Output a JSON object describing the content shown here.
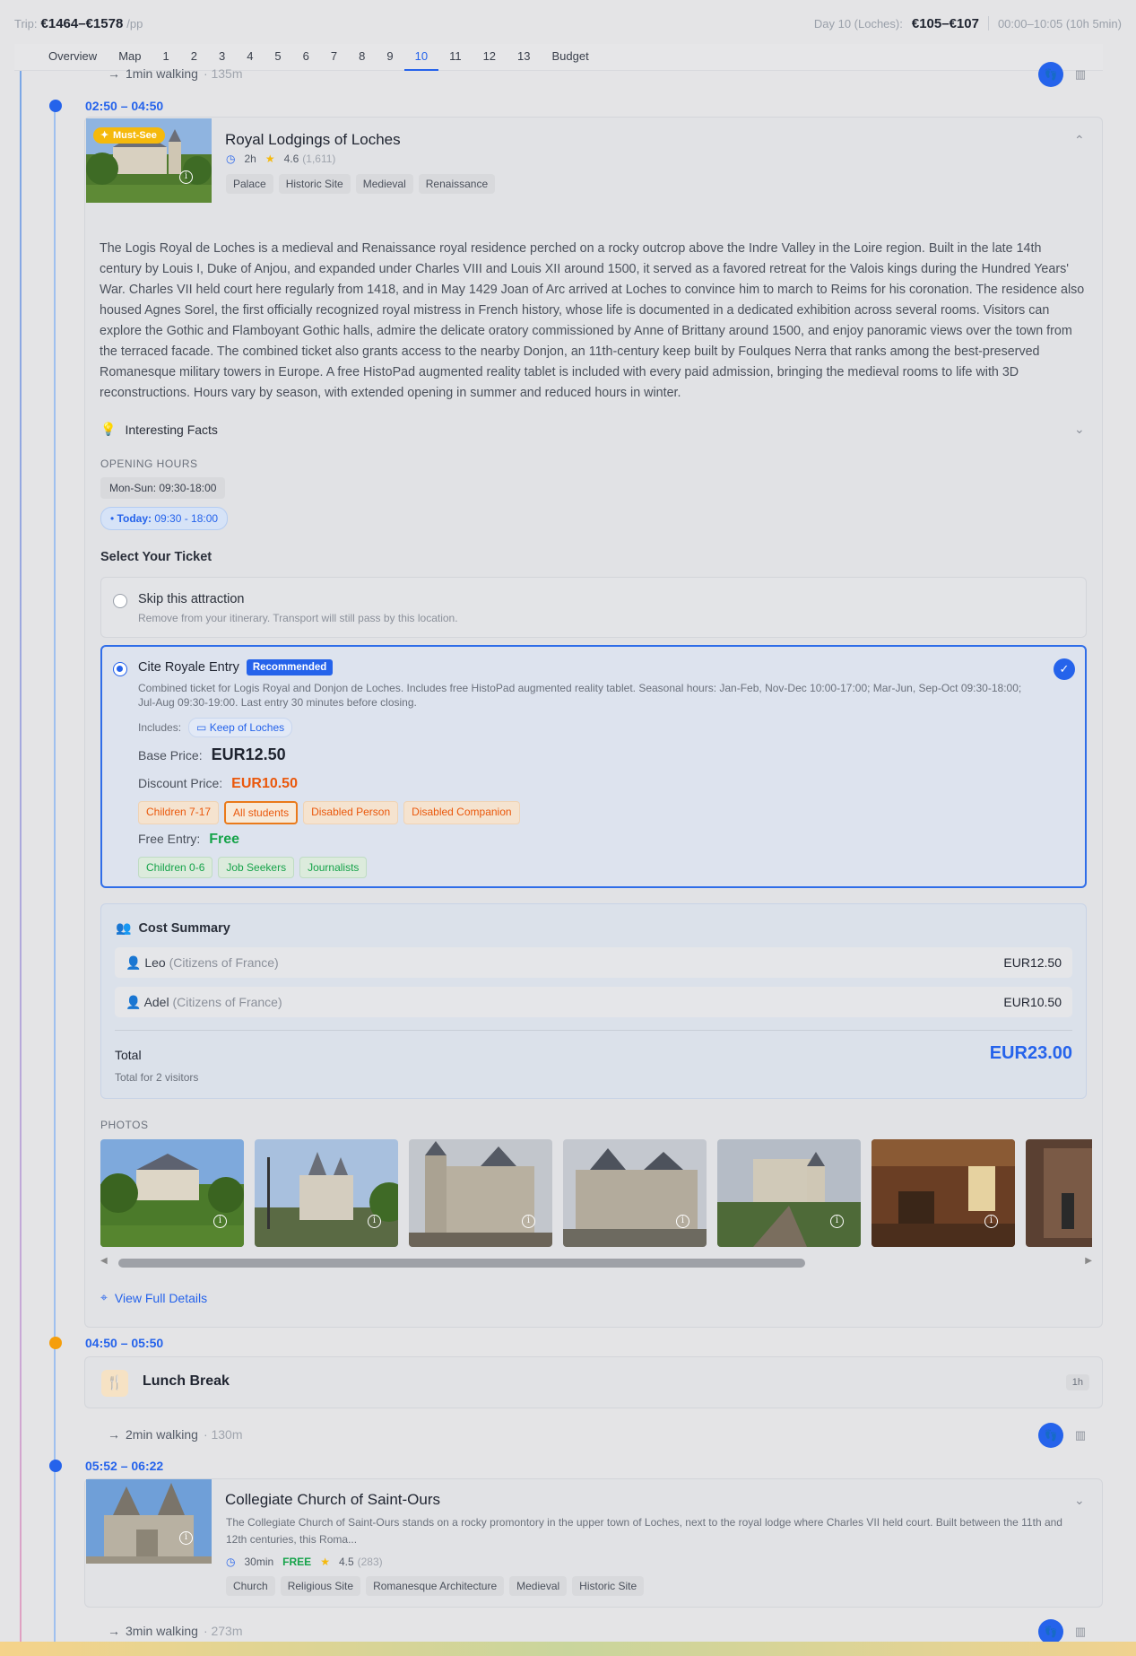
{
  "topbar": {
    "trip_label": "Trip:",
    "trip_value": "€1464–€1578",
    "trip_unit": "/pp",
    "day_label": "Day 10 (Loches):",
    "day_value": "€105–€107",
    "day_time": "00:00–10:05 (10h 5min)"
  },
  "tabs": [
    "Overview",
    "Map",
    "1",
    "2",
    "3",
    "4",
    "5",
    "6",
    "7",
    "8",
    "9",
    "10",
    "11",
    "12",
    "13",
    "Budget"
  ],
  "active_tab": "10",
  "walk1": {
    "label": "1min walking",
    "dist": "· 135m"
  },
  "main": {
    "time": "02:50 – 04:50",
    "badge": "Must-See",
    "title": "Royal Lodgings of Loches",
    "duration": "2h",
    "rating": "4.6",
    "reviews": "(1,611)",
    "tags": [
      "Palace",
      "Historic Site",
      "Medieval",
      "Renaissance"
    ],
    "description": "The Logis Royal de Loches is a medieval and Renaissance royal residence perched on a rocky outcrop above the Indre Valley in the Loire region. Built in the late 14th century by Louis I, Duke of Anjou, and expanded under Charles VIII and Louis XII around 1500, it served as a favored retreat for the Valois kings during the Hundred Years' War. Charles VII held court here regularly from 1418, and in May 1429 Joan of Arc arrived at Loches to convince him to march to Reims for his coronation. The residence also housed Agnes Sorel, the first officially recognized royal mistress in French history, whose life is documented in a dedicated exhibition across several rooms. Visitors can explore the Gothic and Flamboyant Gothic halls, admire the delicate oratory commissioned by Anne of Brittany around 1500, and enjoy panoramic views over the town from the terraced facade. The combined ticket also grants access to the nearby Donjon, an 11th-century keep built by Foulques Nerra that ranks among the best-preserved Romanesque military towers in Europe. A free HistoPad augmented reality tablet is included with every paid admission, bringing the medieval rooms to life with 3D reconstructions. Hours vary by season, with extended opening in summer and reduced hours in winter.",
    "facts_label": "Interesting Facts",
    "hours_title": "OPENING HOURS",
    "hours": "Mon-Sun: 09:30-18:00",
    "today_label": "Today:",
    "today_hours": "09:30 - 18:00",
    "select_ticket": "Select Your Ticket",
    "skip": {
      "title": "Skip this attraction",
      "sub": "Remove from your itinerary. Transport will still pass by this location."
    },
    "ticket": {
      "title": "Cite Royale Entry",
      "badge": "Recommended",
      "desc": "Combined ticket for Logis Royal and Donjon de Loches. Includes free HistoPad augmented reality tablet. Seasonal hours: Jan-Feb, Nov-Dec 10:00-17:00; Mar-Jun, Sep-Oct 09:30-18:00; Jul-Aug 09:30-19:00. Last entry 30 minutes before closing.",
      "includes_label": "Includes:",
      "includes": "Keep of Loches",
      "base_label": "Base Price:",
      "base_price": "EUR12.50",
      "discount_label": "Discount Price:",
      "discount_price": "EUR10.50",
      "discount_groups": [
        "Children 7-17",
        "All students",
        "Disabled Person",
        "Disabled Companion"
      ],
      "free_label": "Free Entry:",
      "free_value": "Free",
      "free_groups": [
        "Children 0-6",
        "Job Seekers",
        "Journalists"
      ]
    },
    "cost": {
      "title": "Cost Summary",
      "rows": [
        {
          "name": "Leo",
          "group": "(Citizens of France)",
          "price": "EUR12.50"
        },
        {
          "name": "Adel",
          "group": "(Citizens of France)",
          "price": "EUR10.50"
        }
      ],
      "total_label": "Total",
      "total_sub": "Total for 2 visitors",
      "total": "EUR23.00"
    },
    "photos_label": "PHOTOS",
    "view_details": "View Full Details"
  },
  "lunch": {
    "time": "04:50 – 05:50",
    "title": "Lunch Break",
    "duration": "1h"
  },
  "walk2": {
    "label": "2min walking",
    "dist": "· 130m"
  },
  "church": {
    "time": "05:52 – 06:22",
    "title": "Collegiate Church of Saint-Ours",
    "desc": "The Collegiate Church of Saint-Ours stands on a rocky promontory in the upper town of Loches, next to the royal lodge where Charles VII held court. Built between the 11th and 12th centuries, this Roma...",
    "duration": "30min",
    "price": "FREE",
    "rating": "4.5",
    "reviews": "(283)",
    "tags": [
      "Church",
      "Religious Site",
      "Romanesque Architecture",
      "Medieval",
      "Historic Site"
    ]
  },
  "walk3": {
    "label": "3min walking",
    "dist": "· 273m"
  },
  "colors": {
    "accent": "#2563eb",
    "orange": "#f59e0b",
    "discount": "#ea580c",
    "free": "#16a34a"
  }
}
